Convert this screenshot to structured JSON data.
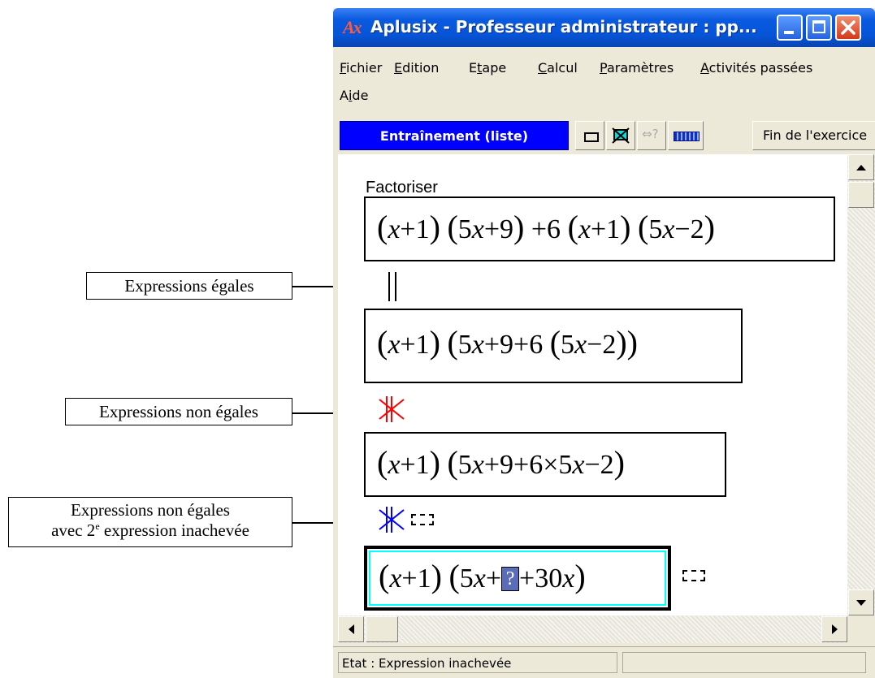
{
  "annotations": {
    "equal": "Expressions égales",
    "not_equal": "Expressions non égales",
    "not_equal_unfinished_line1": "Expressions non égales",
    "not_equal_unfinished_pre": "avec 2",
    "not_equal_unfinished_sup": "e",
    "not_equal_unfinished_post": " expression inachevée"
  },
  "window": {
    "logo": "Ax",
    "title": "Aplusix - Professeur administrateur : pp..."
  },
  "menu": {
    "items": [
      {
        "first": "F",
        "rest": "ichier"
      },
      {
        "first": "E",
        "rest": "dition"
      },
      {
        "pre": "E",
        "first": "t",
        "rest": "ape"
      },
      {
        "first": "C",
        "rest": "alcul"
      },
      {
        "first": "P",
        "rest": "aramètres"
      },
      {
        "first": "A",
        "rest": "ctivités passées"
      },
      {
        "pre": "A",
        "first": "i",
        "rest": "de"
      }
    ]
  },
  "toolbar": {
    "mode_label": "Entraînement (liste)",
    "equiv_icon_text": "⇔?",
    "finish_label": "Fin de l'exercice"
  },
  "workspace": {
    "subject": "Factoriser",
    "steps": [
      {
        "terms": [
          "(",
          "x",
          " +1",
          ")",
          " ",
          "(",
          "5",
          "x",
          " +9",
          ")",
          " +6 ",
          "(",
          "x",
          " +1",
          ")",
          " ",
          "(",
          "5",
          "x",
          " −2",
          ")"
        ],
        "relation": "equal"
      },
      {
        "relation": "not_equal"
      },
      {
        "relation": "not_equal_unfinished"
      }
    ],
    "expr1": {
      "a": "(",
      "b": "x",
      "c": "+1",
      "d": ")",
      "e": "(",
      "f": "5",
      "g": "x",
      "h": "+9",
      "i": ")",
      "j": "+6",
      "k": "(",
      "l": "x",
      "m": "+1",
      "n": ")",
      "o": "(",
      "p": "5",
      "q": "x",
      "r": "−2",
      "s": ")"
    },
    "expr2": {
      "a": "(",
      "b": "x",
      "c": "+1",
      "d": ")",
      "e": "(",
      "f": "5",
      "g": "x",
      "h": "+9+6",
      "i": "(",
      "j": "5",
      "k": "x",
      "l": "−2",
      "m": ")",
      "n": ")"
    },
    "expr3": {
      "a": "(",
      "b": "x",
      "c": "+1",
      "d": ")",
      "e": "(",
      "f": "5",
      "g": "x",
      "h": "+9+6×5",
      "i": "x",
      "j": "−2",
      "k": ")"
    },
    "expr4": {
      "a": "(",
      "b": "x",
      "c": "+1",
      "d": ")",
      "e": "(",
      "f": "5",
      "g": "x",
      "h": "+",
      "q": "?",
      "i": "+30",
      "j": "x",
      "k": ")"
    }
  },
  "status": {
    "text": "Etat : Expression inachevée"
  },
  "colors": {
    "mode_button": "#0000ff",
    "not_equal_red": "#ff0000",
    "not_equal_blue": "#0000ff",
    "active_box": "#00ffff"
  }
}
